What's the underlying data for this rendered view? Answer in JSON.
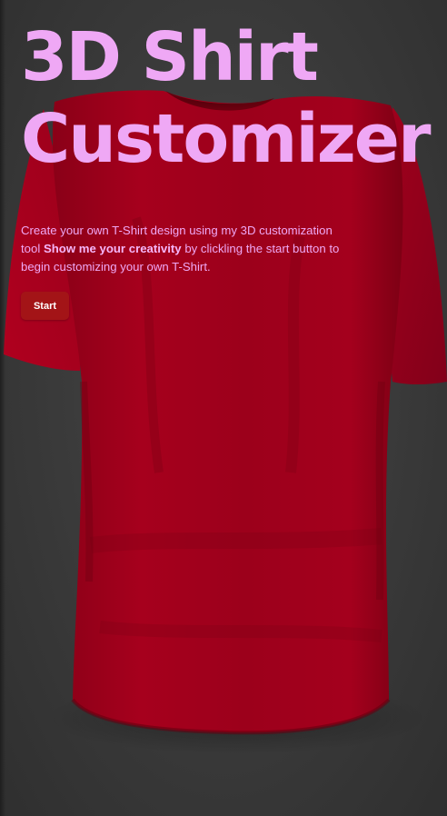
{
  "hero": {
    "title_line1": "3D Shirt",
    "title_line2": "Customizer",
    "intro_before": "Create your own T-Shirt design using my 3D customization tool ",
    "intro_bold": "Show me your creativity",
    "intro_after": " by clickling the start button to begin customizing your own T-Shirt.",
    "start_label": "Start"
  },
  "colors": {
    "accent": "#efa8f5",
    "shirt": "#a3001c",
    "button": "#a31417",
    "background": "#3c3c3c"
  },
  "icons": {
    "shirt": "t-shirt-3d-model"
  }
}
